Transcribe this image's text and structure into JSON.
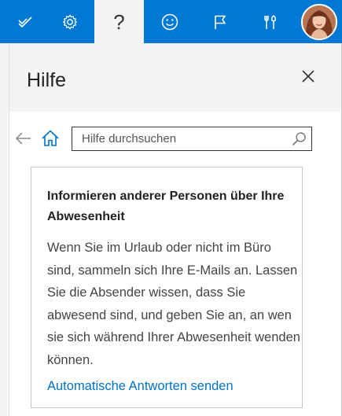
{
  "colors": {
    "topbar": "#0078d4",
    "link": "#0072c6",
    "panel_bg": "#f4f4f4"
  },
  "topbar": {
    "buttons": [
      {
        "icon": "checkmark-icon",
        "active": false
      },
      {
        "icon": "gear-icon",
        "active": false
      },
      {
        "icon": "help-icon",
        "label": "?",
        "active": true
      },
      {
        "icon": "smiley-icon",
        "active": false
      },
      {
        "icon": "flag-icon",
        "active": false
      },
      {
        "icon": "tools-icon",
        "active": false
      }
    ]
  },
  "panel": {
    "title": "Hilfe",
    "search": {
      "placeholder": "Hilfe durchsuchen",
      "value": ""
    },
    "card": {
      "title": "Informieren anderer Personen über Ihre Abwesenheit",
      "body": "Wenn Sie im Urlaub oder nicht im Büro sind, sammeln sich Ihre E-Mails an. Lassen Sie die Absender wissen, dass Sie abwesend sind, und geben Sie an, an wen sie sich während Ihrer Abwesenheit wenden können.",
      "link": "Automatische Antworten senden"
    }
  }
}
